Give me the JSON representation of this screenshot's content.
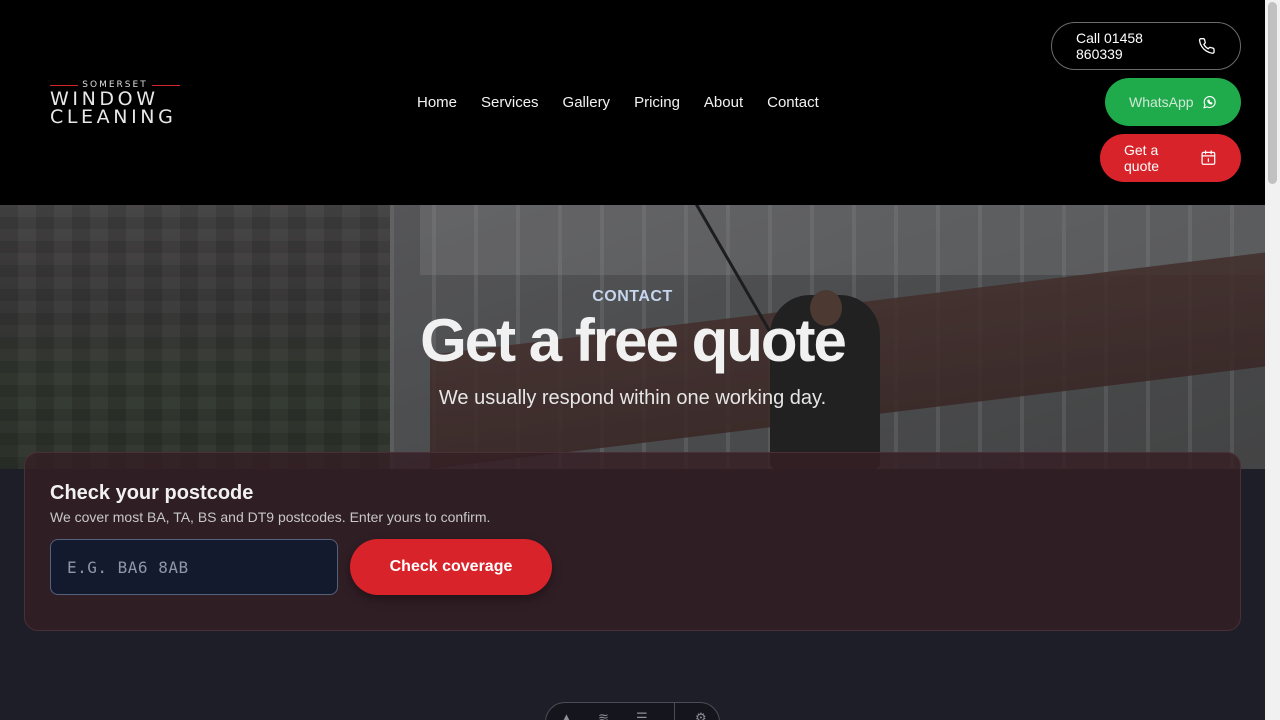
{
  "logo": {
    "top": "SOMERSET",
    "line1": "WINDOW",
    "line2": "CLEANING"
  },
  "nav": [
    "Home",
    "Services",
    "Gallery",
    "Pricing",
    "About",
    "Contact"
  ],
  "buttons": {
    "call": "Call 01458 860339",
    "whatsapp": "WhatsApp",
    "quote": "Get a quote"
  },
  "hero": {
    "kicker": "CONTACT",
    "title": "Get a free quote",
    "subtitle": "We usually respond within one working day."
  },
  "postcode": {
    "heading": "Check your postcode",
    "description": "We cover most BA, TA, BS and DT9 postcodes. Enter yours to confirm.",
    "placeholder": "E.G. BA6 8AB",
    "button": "Check coverage"
  },
  "icons": {
    "phone": "phone-icon",
    "whatsapp": "whatsapp-icon",
    "quote": "calendar-icon"
  },
  "colors": {
    "brand_red": "#d8232a",
    "whatsapp_green": "#1faa4b",
    "header_bg": "#000000",
    "page_bg": "#1d1e28"
  }
}
